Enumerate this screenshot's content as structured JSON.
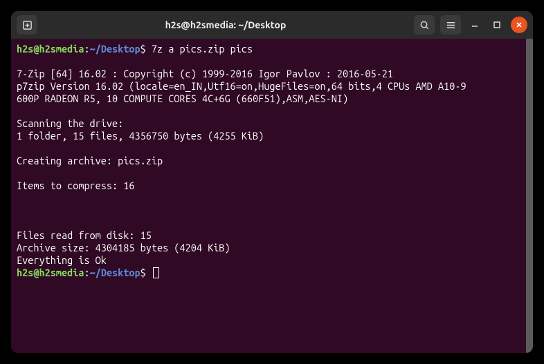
{
  "titlebar": {
    "title": "h2s@h2smedia: ~/Desktop"
  },
  "prompt": {
    "user_host": "h2s@h2smedia",
    "colon": ":",
    "path": "~/Desktop",
    "dollar": "$"
  },
  "command": "7z a pics.zip pics",
  "output": {
    "line_7zip": "7-Zip [64] 16.02 : Copyright (c) 1999-2016 Igor Pavlov : 2016-05-21",
    "line_p7zip1": "p7zip Version 16.02 (locale=en_IN,Utf16=on,HugeFiles=on,64 bits,4 CPUs AMD A10-9",
    "line_p7zip2": "600P RADEON R5, 10 COMPUTE CORES 4C+6G (660F51),ASM,AES-NI)",
    "scan_hdr": "Scanning the drive:",
    "scan_res": "1 folder, 15 files, 4356750 bytes (4255 KiB)",
    "creating": "Creating archive: pics.zip",
    "items": "Items to compress: 16",
    "files_read": "Files read from disk: 15",
    "archive_size": "Archive size: 4304185 bytes (4204 KiB)",
    "everything_ok": "Everything is Ok"
  }
}
